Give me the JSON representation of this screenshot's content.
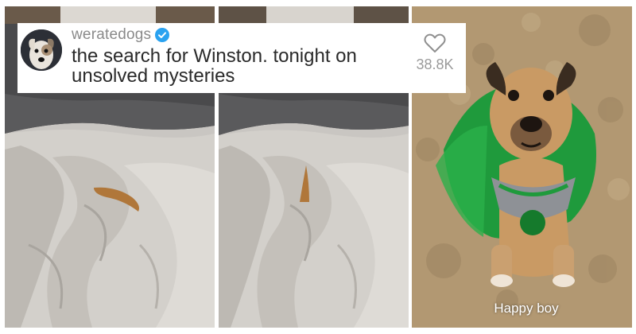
{
  "post": {
    "username": "weratedogs",
    "verified_icon": "verified-badge-icon",
    "caption": "the search for Winston. tonight on unsolved mysteries",
    "likes": "38.8K",
    "like_icon": "heart-outline-icon"
  },
  "panels": [
    {
      "name": "bed-sheet-tail-panel-1"
    },
    {
      "name": "bed-sheet-tail-panel-2"
    },
    {
      "name": "dog-green-tutu-panel",
      "subtitle": "Happy boy"
    }
  ],
  "colors": {
    "verified": "#2aa2f0",
    "username": "#8a8a8a",
    "caption": "#2a2a2a",
    "likes": "#9a9a9a",
    "tutu_green": "#1f9a3c",
    "carpet": "#b29872"
  }
}
